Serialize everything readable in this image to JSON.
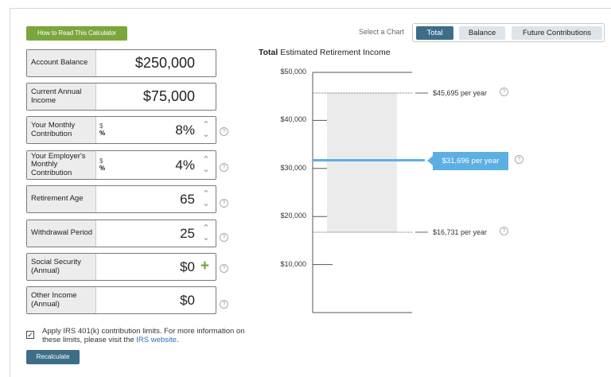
{
  "howto_label": "How to Read This Calculator",
  "fields": {
    "account_balance": {
      "label": "Account Balance",
      "value": "$250,000"
    },
    "current_income": {
      "label": "Current Annual Income",
      "value": "$75,000"
    },
    "monthly_contribution": {
      "label": "Your Monthly Contribution",
      "unit_dollar": "$",
      "unit_pct": "%",
      "value": "8%"
    },
    "employer_contribution": {
      "label": "Your Employer's Monthly Contribution",
      "unit_dollar": "$",
      "unit_pct": "%",
      "value": "4%"
    },
    "retirement_age": {
      "label": "Retirement Age",
      "value": "65"
    },
    "withdrawal_period": {
      "label": "Withdrawal Period",
      "value": "25"
    },
    "social_security": {
      "label": "Social Security (Annual)",
      "value": "$0"
    },
    "other_income": {
      "label": "Other Income (Annual)",
      "value": "$0"
    }
  },
  "irs": {
    "checked": true,
    "text": "Apply IRS 401(k) contribution limits. For more information on these limits, please visit the ",
    "link": "IRS website",
    "suffix": "."
  },
  "recalculate_label": "Recalculate",
  "select_chart_label": "Select a Chart",
  "tabs": [
    {
      "label": "Total",
      "active": true
    },
    {
      "label": "Balance",
      "active": false
    },
    {
      "label": "Future Contributions",
      "active": false
    }
  ],
  "chart_title_bold": "Total",
  "chart_title_rest": " Estimated Retirement Income",
  "chart_data": {
    "type": "bar",
    "ylim": [
      0,
      50000
    ],
    "y_ticks": [
      "$50,000",
      "$40,000",
      "$30,000",
      "$20,000",
      "$10,000"
    ],
    "y_tick_values": [
      50000,
      40000,
      30000,
      20000,
      10000
    ],
    "range_high": 45695,
    "range_low": 16731,
    "estimate": 31696,
    "high_label": "$45,695 per year",
    "low_label": "$16,731 per year",
    "estimate_label": "$31,696 per year"
  },
  "colors": {
    "accent": "#3d6e88",
    "green": "#7ba63c",
    "bar": "#ebebeb",
    "estimate": "#5dafe3"
  }
}
